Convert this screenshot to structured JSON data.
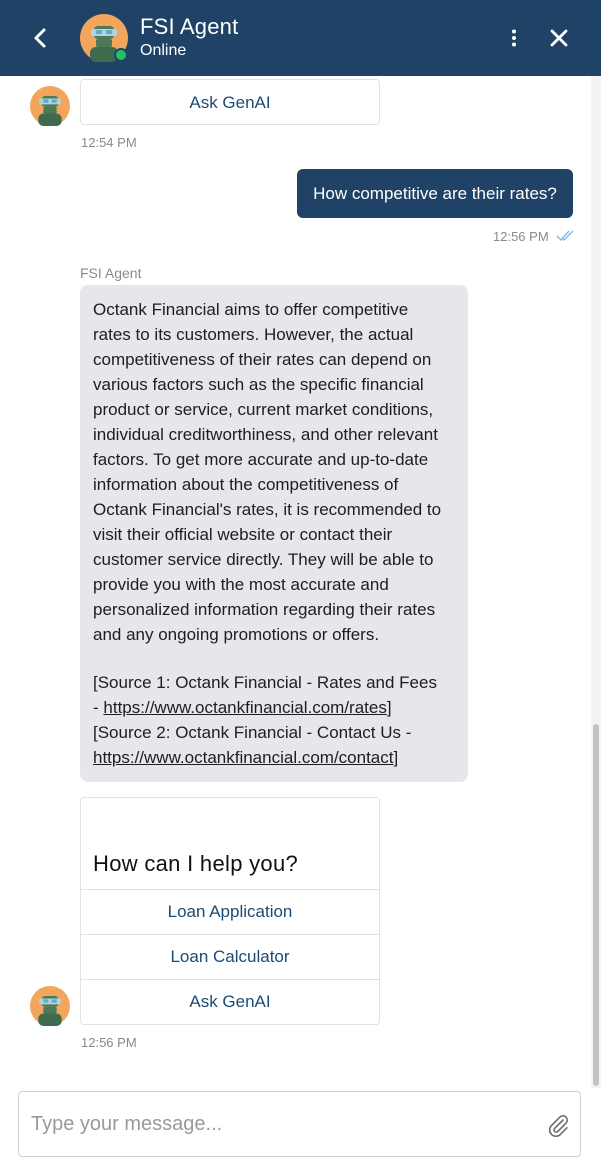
{
  "header": {
    "agent_name": "FSI Agent",
    "status": "Online",
    "bg_color": "#1f4266",
    "status_color": "#21c261",
    "icons": [
      "chevron-left-icon",
      "more-vertical-icon",
      "close-icon"
    ]
  },
  "messages": {
    "top_card": {
      "button": "Ask GenAI",
      "time": "12:54 PM"
    },
    "user_message": {
      "text": "How competitive are their rates?",
      "time": "12:56 PM"
    },
    "agent_reply": {
      "sender": "FSI Agent",
      "line1": "Octank Financial aims to offer competitive",
      "line2": "rates to its customers. However, the actual",
      "line3": "competitiveness of their rates can depend on",
      "line4": "various factors such as the specific financial",
      "line5": "product or service, current market conditions,",
      "line6": "individual creditworthiness, and other relevant",
      "line7": "factors. To get more accurate and up-to-date",
      "line8": "information about the competitiveness of",
      "line9": "Octank Financial's rates, it is recommended to",
      "line10": "visit their official website or contact their",
      "line11": "customer service directly. They will be able to",
      "line12": "provide you with the most accurate and",
      "line13": "personalized information regarding their rates",
      "line14": "and any ongoing promotions or offers.",
      "source1_prefix": "[Source 1: Octank Financial - Rates and Fees",
      "source1_dash": "- ",
      "source1_url": "https://www.octankfinancial.com/rates",
      "source1_close": "]",
      "source2_prefix": "[Source 2: Octank Financial - Contact Us -",
      "source2_url": "https://www.octankfinancial.com/contact",
      "source2_close": "]"
    },
    "help_card": {
      "title": "How can I help you?",
      "buttons": [
        "Loan Application",
        "Loan Calculator",
        "Ask GenAI"
      ],
      "time": "12:56 PM"
    }
  },
  "composer": {
    "placeholder": "Type your message...",
    "attach_icon": "paperclip-icon"
  }
}
